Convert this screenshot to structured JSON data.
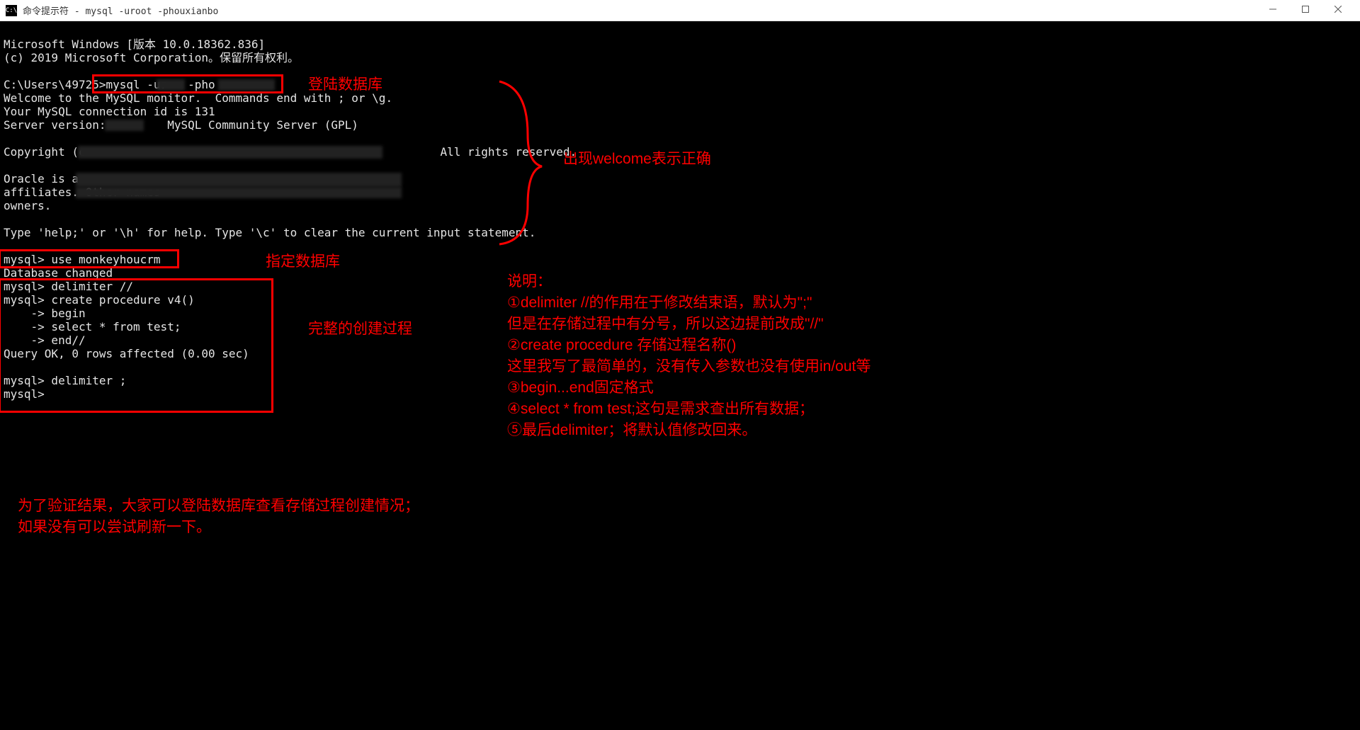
{
  "window": {
    "title": "命令提示符 - mysql  -uroot -phouxianbo",
    "icon_label": "C:\\"
  },
  "terminal": {
    "line1": "Microsoft Windows [版本 10.0.18362.836]",
    "line2": "(c) 2019 Microsoft Corporation。保留所有权利。",
    "blank1": "",
    "line3a": "C:\\Users\\49725>",
    "line3b": "mysql -ur",
    "line3c": "   -pho",
    "line4": "Welcome to the MySQL monitor.  Commands end with ; or \\g.",
    "line5": "Your MySQL connection id is 131",
    "line6a": "Server version: ",
    "line6b": " MySQL Community Server (GPL)",
    "blank2": "",
    "line7a": "Copyright (c",
    "line7b": "All rights reserved.",
    "blank3": "",
    "line8a": "Oracle is a ",
    "line9a": "affiliates. Other names ",
    "line10": "owners.",
    "blank4": "",
    "line11": "Type 'help;' or '\\h' for help. Type '\\c' to clear the current input statement.",
    "blank5": "",
    "line12": "mysql> use monkeyhoucrm",
    "line13": "Database changed",
    "line14": "mysql> delimiter //",
    "line15": "mysql> create procedure v4()",
    "line16": "    -> begin",
    "line17": "    -> select * from test;",
    "line18": "    -> end//",
    "line19": "Query OK, 0 rows affected (0.00 sec)",
    "blank6": "",
    "line20": "mysql> delimiter ;",
    "line21": "mysql>"
  },
  "annotations": {
    "a1": "登陆数据库",
    "a2": "出现welcome表示正确",
    "a3": "指定数据库",
    "a4": "完整的创建过程",
    "a5_title": "说明：",
    "a5_l1": "①delimiter //的作用在于修改结束语，默认为\";\"",
    "a5_l2": "但是在存储过程中有分号，所以这边提前改成\"//\"",
    "a5_l3": "②create procedure 存储过程名称()",
    "a5_l4": "这里我写了最简单的，没有传入参数也没有使用in/out等",
    "a5_l5": "③begin...end固定格式",
    "a5_l6": "④select * from test;这句是需求查出所有数据；",
    "a5_l7": "⑤最后delimiter；将默认值修改回来。",
    "a6_l1": "为了验证结果，大家可以登陆数据库查看存储过程创建情况；",
    "a6_l2": "如果没有可以尝试刷新一下。"
  }
}
